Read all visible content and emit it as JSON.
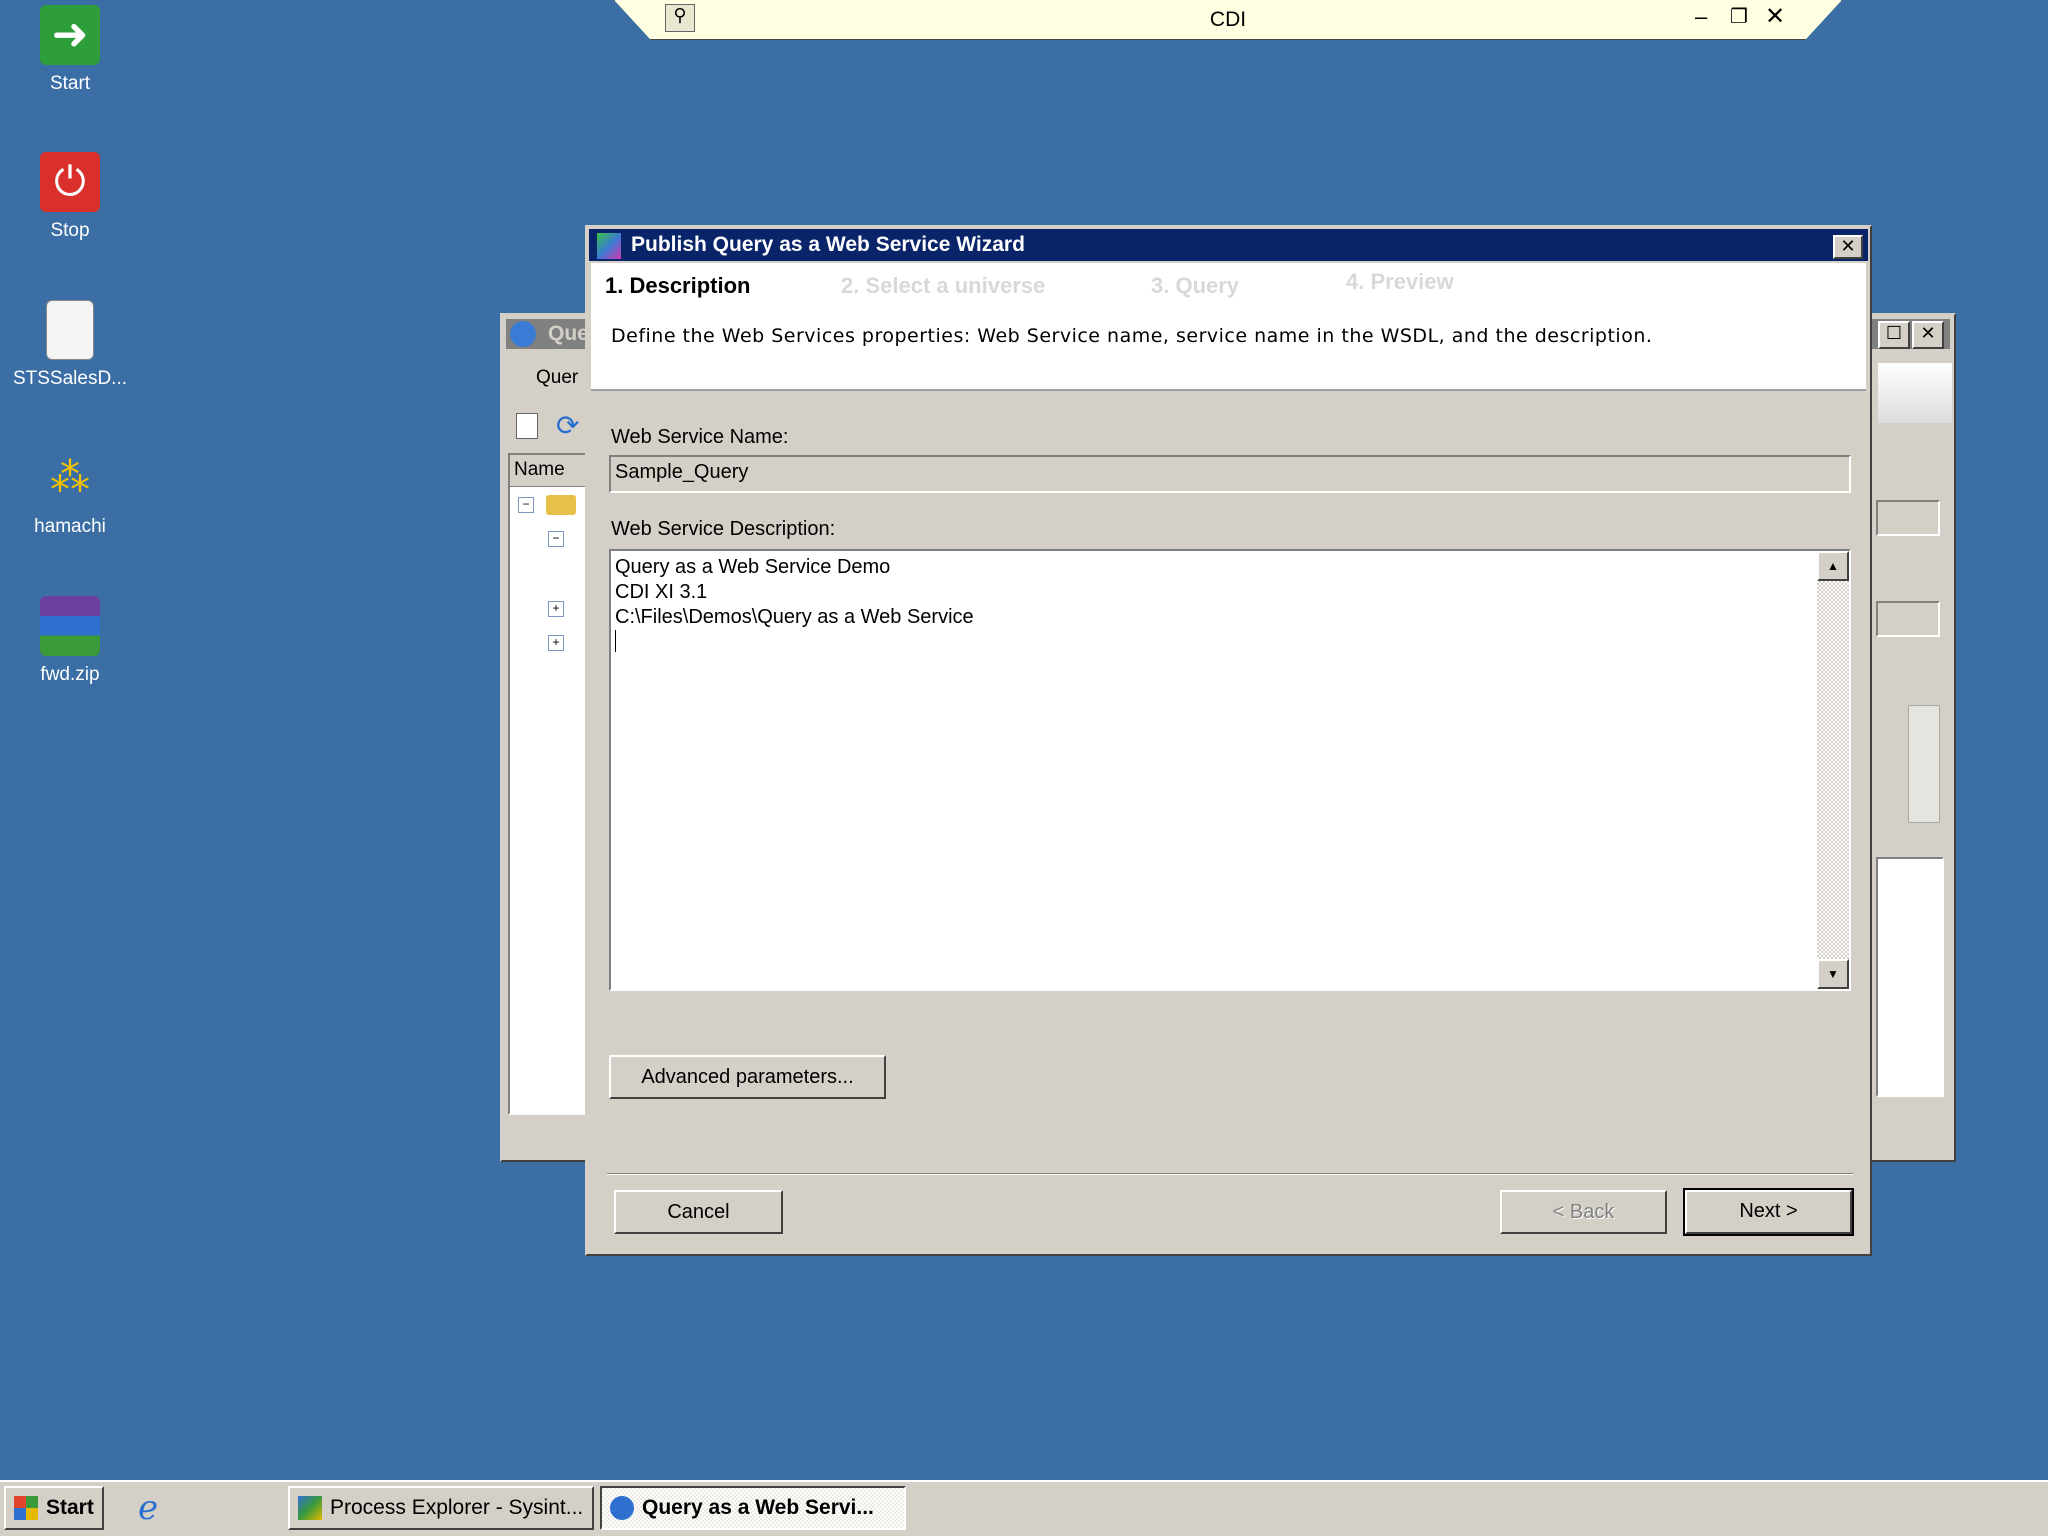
{
  "desktop": {
    "icons": [
      {
        "label": "Start",
        "icon": "green-arrow-icon",
        "color": "#2e9e3a"
      },
      {
        "label": "Stop",
        "icon": "power-icon",
        "color": "#d9302b"
      },
      {
        "label": "STSSalesD...",
        "icon": "document-icon",
        "color": "#f4f4f4"
      },
      {
        "label": "hamachi",
        "icon": "hamachi-icon",
        "color": "#f2c200"
      },
      {
        "label": "fwd.zip",
        "icon": "winrar-archive-icon",
        "color": "#6b3fa0"
      }
    ]
  },
  "topbar": {
    "title": "CDI"
  },
  "back_window": {
    "title": "Que",
    "menu": "Quer",
    "column": "Name"
  },
  "wizard": {
    "title": "Publish Query as a Web Service Wizard",
    "steps": [
      {
        "label": "1. Description",
        "active": true
      },
      {
        "label": "2. Select a universe",
        "active": false
      },
      {
        "label": "3. Query",
        "active": false
      },
      {
        "label": "4. Preview",
        "active": false
      }
    ],
    "instructions": "Define the Web Services properties: Web Service name, service name in the WSDL, and the description.",
    "name_label": "Web Service Name:",
    "name_value": "Sample_Query",
    "desc_label": "Web Service Description:",
    "desc_lines": [
      "Query as a Web Service Demo",
      "CDI XI 3.1",
      "C:\\Files\\Demos\\Query as a Web Service"
    ],
    "advanced_label": "Advanced parameters...",
    "cancel_label": "Cancel",
    "back_label": "< Back",
    "next_label": "Next >"
  },
  "taskbar": {
    "start": "Start",
    "items": [
      "Process Explorer - Sysint...",
      "Query as a Web Servi..."
    ]
  }
}
